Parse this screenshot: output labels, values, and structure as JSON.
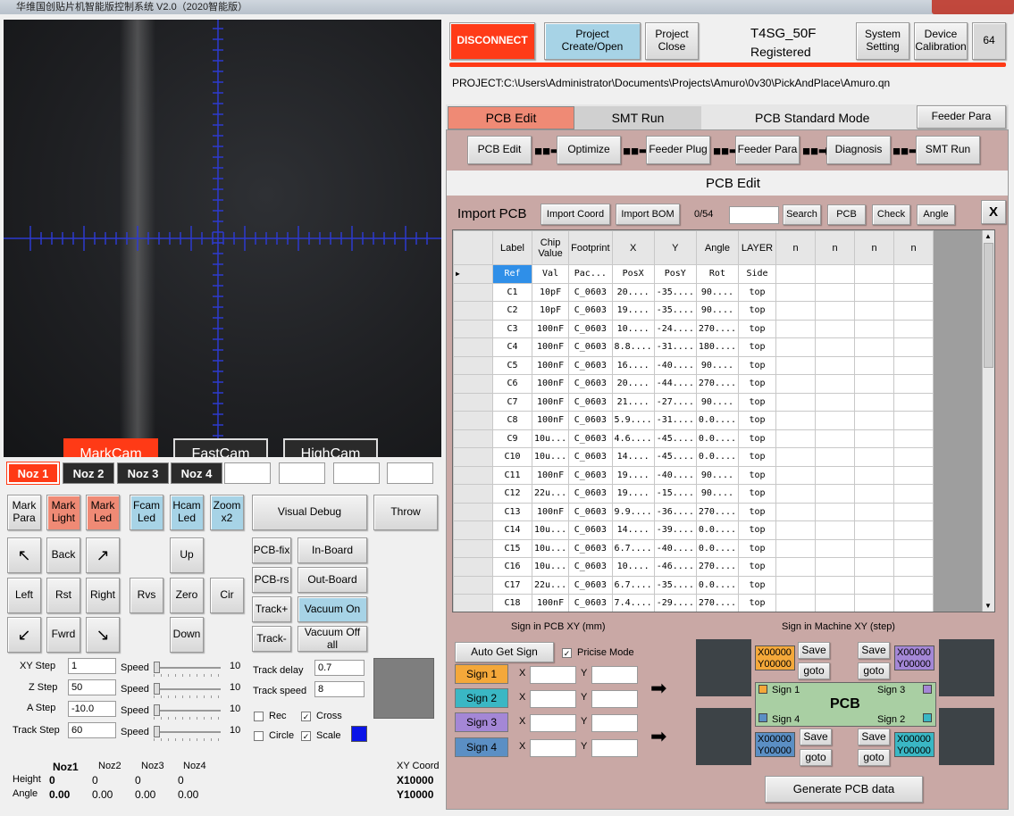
{
  "window": {
    "title": "华维国创贴片机智能版控制系统 V2.0（2020智能版）"
  },
  "top": {
    "disconnect": "DISCONNECT",
    "project_create": "Project\nCreate/Open",
    "project_close": "Project\nClose",
    "machine_model": "T4SG_50F",
    "registered": "Registered",
    "system_setting": "System\nSetting",
    "device_calibration": "Device\nCalibration",
    "count": "64"
  },
  "project_path": "PROJECT:C:\\Users\\Administrator\\Documents\\Projects\\Amuro\\0v30\\PickAndPlace\\Amuro.qn",
  "tabs": {
    "pcb_edit": "PCB Edit",
    "smt_run": "SMT Run",
    "mode": "PCB Standard Mode",
    "feeder_para": "Feeder Para"
  },
  "flow": [
    "PCB Edit",
    "Optimize",
    "Feeder Plug",
    "Feeder Para",
    "Diagnosis",
    "SMT Run"
  ],
  "section_title": "PCB Edit",
  "import": {
    "title": "Import PCB",
    "import_coord": "Import Coord",
    "import_bom": "Import BOM",
    "count": "0/54",
    "search": "Search",
    "pcb": "PCB",
    "check": "Check",
    "angle": "Angle",
    "close": "X"
  },
  "table": {
    "headers": [
      "Label",
      "Chip\nValue",
      "Footprint",
      "X",
      "Y",
      "Angle",
      "LAYER",
      "n",
      "n",
      "n",
      "n"
    ],
    "rows": [
      [
        "Ref",
        "Val",
        "Pac...",
        "PosX",
        "PosY",
        "Rot",
        "Side"
      ],
      [
        "C1",
        "10pF",
        "C_0603",
        "20....",
        "-35....",
        "90....",
        "top"
      ],
      [
        "C2",
        "10pF",
        "C_0603",
        "19....",
        "-35....",
        "90....",
        "top"
      ],
      [
        "C3",
        "100nF",
        "C_0603",
        "10....",
        "-24....",
        "270....",
        "top"
      ],
      [
        "C4",
        "100nF",
        "C_0603",
        "8.8....",
        "-31....",
        "180....",
        "top"
      ],
      [
        "C5",
        "100nF",
        "C_0603",
        "16....",
        "-40....",
        "90....",
        "top"
      ],
      [
        "C6",
        "100nF",
        "C_0603",
        "20....",
        "-44....",
        "270....",
        "top"
      ],
      [
        "C7",
        "100nF",
        "C_0603",
        "21....",
        "-27....",
        "90....",
        "top"
      ],
      [
        "C8",
        "100nF",
        "C_0603",
        "5.9....",
        "-31....",
        "0.0....",
        "top"
      ],
      [
        "C9",
        "10u...",
        "C_0603",
        "4.6....",
        "-45....",
        "0.0....",
        "top"
      ],
      [
        "C10",
        "10u...",
        "C_0603",
        "14....",
        "-45....",
        "0.0....",
        "top"
      ],
      [
        "C11",
        "100nF",
        "C_0603",
        "19....",
        "-40....",
        "90....",
        "top"
      ],
      [
        "C12",
        "22u...",
        "C_0603",
        "19....",
        "-15....",
        "90....",
        "top"
      ],
      [
        "C13",
        "100nF",
        "C_0603",
        "9.9....",
        "-36....",
        "270....",
        "top"
      ],
      [
        "C14",
        "10u...",
        "C_0603",
        "14....",
        "-39....",
        "0.0....",
        "top"
      ],
      [
        "C15",
        "10u...",
        "C_0603",
        "6.7....",
        "-40....",
        "0.0....",
        "top"
      ],
      [
        "C16",
        "10u...",
        "C_0603",
        "10....",
        "-46....",
        "270....",
        "top"
      ],
      [
        "C17",
        "22u...",
        "C_0603",
        "6.7....",
        "-35....",
        "0.0....",
        "top"
      ],
      [
        "C18",
        "100nF",
        "C_0603",
        "7.4....",
        "-29....",
        "270....",
        "top"
      ]
    ]
  },
  "sign_pcb": {
    "title": "Sign in PCB XY (mm)",
    "auto_get": "Auto Get Sign",
    "precise_mode": "Pricise Mode",
    "signs": [
      "Sign 1",
      "Sign 2",
      "Sign 3",
      "Sign 4"
    ],
    "x_label": "X",
    "y_label": "Y"
  },
  "sign_machine": {
    "title": "Sign in Machine XY (step)",
    "board_label": "PCB",
    "save": "Save",
    "goto": "goto",
    "xy_value": "X00000\nY00000",
    "marks": [
      "Sign 1",
      "Sign 3",
      "Sign 4",
      "Sign 2"
    ]
  },
  "generate": "Generate PCB data",
  "camera": {
    "tabs": [
      "MarkCam",
      "FastCam",
      "HighCam"
    ]
  },
  "nozzles": [
    "Noz 1",
    "Noz 2",
    "Noz 3",
    "Noz 4"
  ],
  "controls": {
    "row1": [
      "Mark\nPara",
      "Mark\nLight",
      "Mark\nLed",
      "Fcam\nLed",
      "Hcam\nLed",
      "Zoom\nx2"
    ],
    "visual_debug": "Visual Debug",
    "throw": "Throw",
    "jog": {
      "nw": "↖",
      "back": "Back",
      "ne": "↗",
      "left": "Left",
      "rst": "Rst",
      "right": "Right",
      "sw": "↙",
      "fwrd": "Fwrd",
      "se": "↘"
    },
    "z": {
      "up": "Up",
      "rvs": "Rvs",
      "zero": "Zero",
      "cir": "Cir",
      "down": "Down"
    },
    "pcb_fix": "PCB-fix",
    "in_board": "In-Board",
    "pcb_rs": "PCB-rs",
    "out_board": "Out-Board",
    "track_plus": "Track+",
    "vacuum_on": "Vacuum On",
    "track_minus": "Track-",
    "vacuum_off": "Vacuum Off all",
    "steps": [
      {
        "label": "XY Step",
        "value": "1",
        "speed": "Speed",
        "speed_val": "10"
      },
      {
        "label": "Z Step",
        "value": "50",
        "speed": "Speed",
        "speed_val": "10"
      },
      {
        "label": "A Step",
        "value": "-10.0",
        "speed": "Speed",
        "speed_val": "10"
      },
      {
        "label": "Track Step",
        "value": "60",
        "speed": "Speed",
        "speed_val": "10"
      }
    ],
    "track_delay": "Track delay",
    "track_delay_val": "0.7",
    "track_speed": "Track speed",
    "track_speed_val": "8",
    "rec": "Rec",
    "cross": "Cross",
    "circle": "Circle",
    "scale": "Scale"
  },
  "status": {
    "noz_headers": [
      "Noz1",
      "Noz2",
      "Noz3",
      "Noz4"
    ],
    "height_label": "Height",
    "angle_label": "Angle",
    "heights": [
      "0",
      "0",
      "0",
      "0"
    ],
    "angles": [
      "0.00",
      "0.00",
      "0.00",
      "0.00"
    ],
    "xy_title": "XY Coord",
    "x": "X10000",
    "y": "Y10000"
  },
  "colors": {
    "accent_red": "#ff3a16",
    "salmon": "#ef8a75",
    "light_blue": "#a7d3e6",
    "panel_pink": "#c9a8a5",
    "sign1": "#f4a83a",
    "sign2": "#3ab7c4",
    "sign3": "#a487d6",
    "sign4": "#5b8fc4"
  }
}
